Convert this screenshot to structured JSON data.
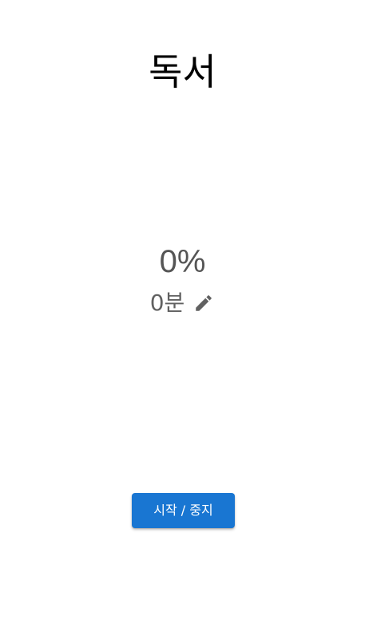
{
  "title": "독서",
  "progress": {
    "percent_label": "0%",
    "minutes_label": "0분"
  },
  "edit_icon": "pencil-icon",
  "start_stop_button": {
    "label": "시작 / 중지",
    "color": "#1976d2"
  }
}
